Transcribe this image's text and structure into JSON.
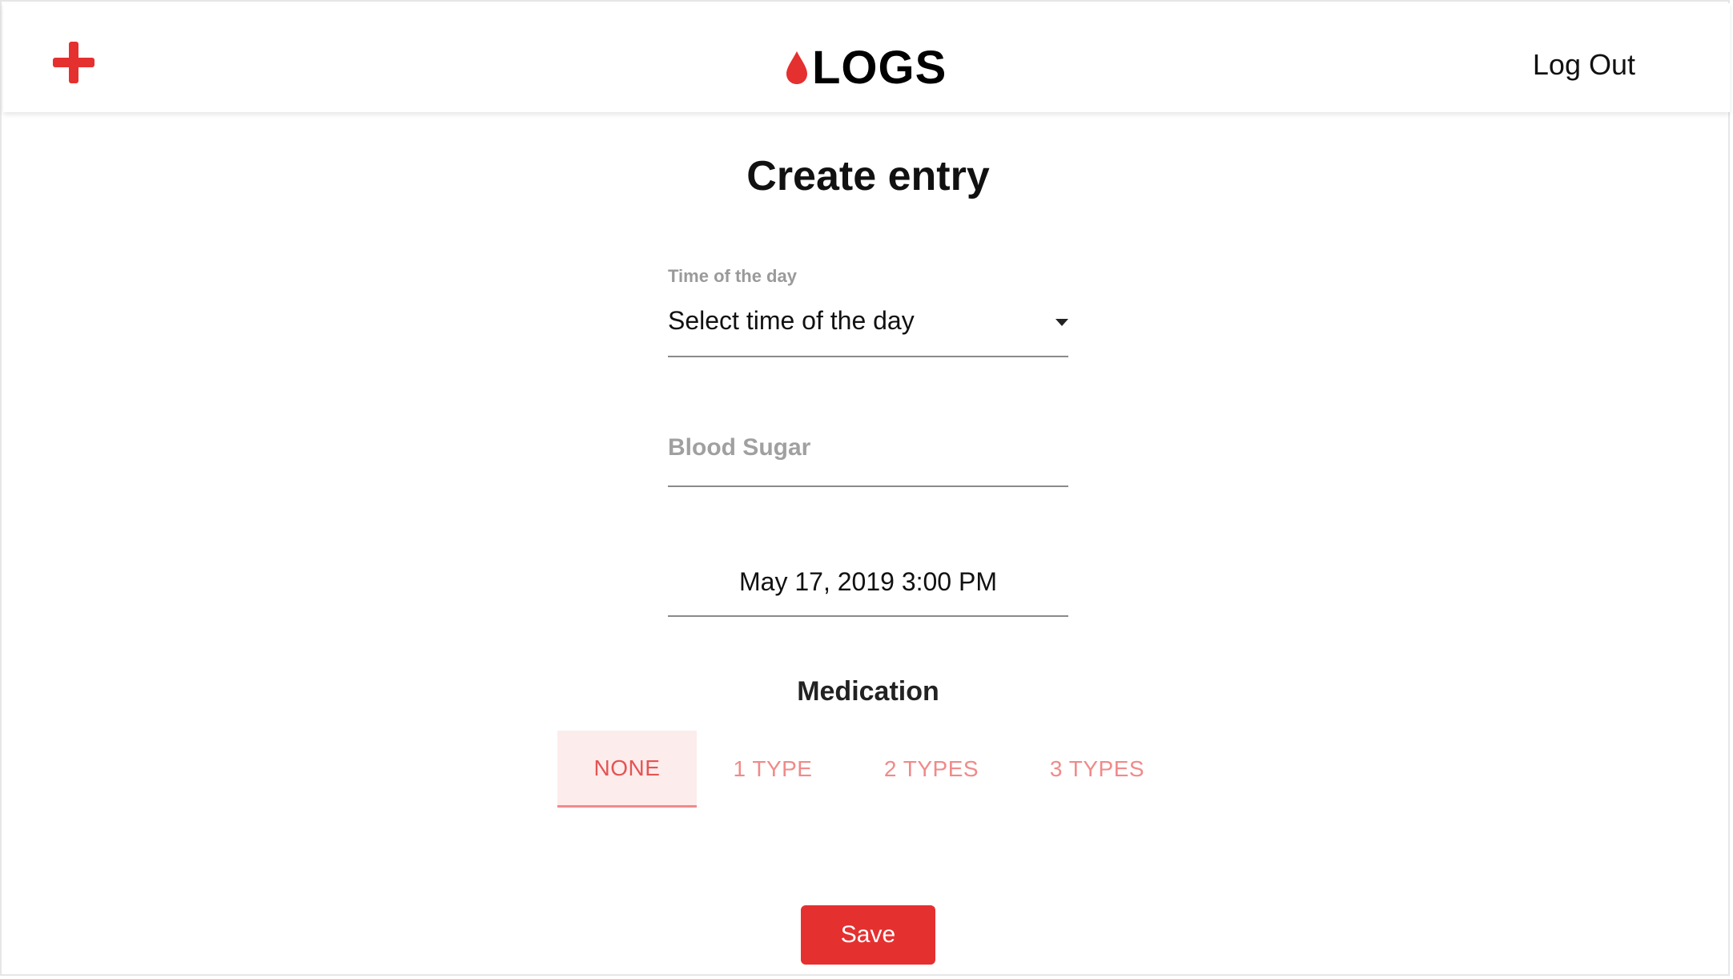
{
  "header": {
    "brand": "LOGS",
    "logout_label": "Log Out"
  },
  "page": {
    "title": "Create entry"
  },
  "form": {
    "time_of_day": {
      "label": "Time of the day",
      "value": "Select time of the day"
    },
    "blood_sugar": {
      "placeholder": "Blood Sugar",
      "value": ""
    },
    "date_time": "May 17, 2019 3:00 PM"
  },
  "medication": {
    "heading": "Medication",
    "options": [
      "NONE",
      "1 TYPE",
      "2 TYPES",
      "3 TYPES"
    ],
    "selected": "NONE"
  },
  "actions": {
    "save_label": "Save"
  },
  "colors": {
    "accent": "#e53030",
    "tab_active_bg": "#fdecec",
    "tab_text": "#f08a8a"
  },
  "icons": {
    "add": "plus-icon",
    "brand": "blood-drop-icon",
    "dropdown": "caret-down-icon"
  }
}
